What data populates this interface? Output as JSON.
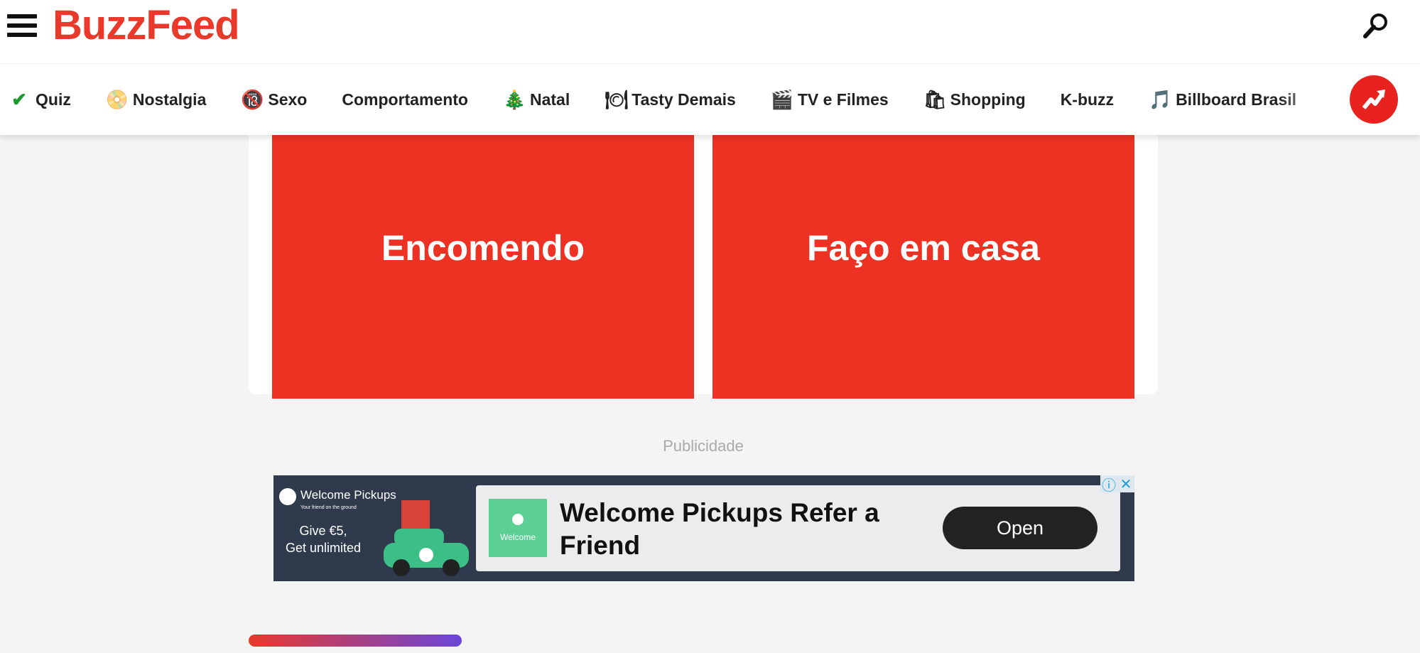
{
  "header": {
    "logo": "BuzzFeed",
    "menu_icon": "hamburger-icon",
    "search_icon": "search-icon"
  },
  "nav": {
    "items": [
      {
        "icon": "✔",
        "label": "Quiz"
      },
      {
        "icon": "📀",
        "label": "Nostalgia"
      },
      {
        "icon": "🔞",
        "label": "Sexo"
      },
      {
        "icon": "",
        "label": "Comportamento"
      },
      {
        "icon": "🎄",
        "label": "Natal"
      },
      {
        "icon": "🍽",
        "label": "Tasty Demais"
      },
      {
        "icon": "🎬",
        "label": "TV e Filmes"
      },
      {
        "icon": "🛍",
        "label": "Shopping"
      },
      {
        "icon": "",
        "label": "K-buzz"
      },
      {
        "icon": "🎵",
        "label": "Billboard Brasil"
      }
    ],
    "trending_icon": "trending-arrow-icon"
  },
  "quiz": {
    "options": [
      "Encomendo",
      "Faço em casa"
    ],
    "accent": "#ed3223"
  },
  "ad": {
    "label": "Publicidade",
    "brand": "Welcome Pickups",
    "tagline": "Your friend on the ground",
    "offer_line1": "Give €5,",
    "offer_line2": "Get unlimited",
    "logo_text": "Welcome",
    "title": "Welcome Pickups Refer a Friend",
    "cta": "Open",
    "info": "ⓘ",
    "close": "✕"
  }
}
